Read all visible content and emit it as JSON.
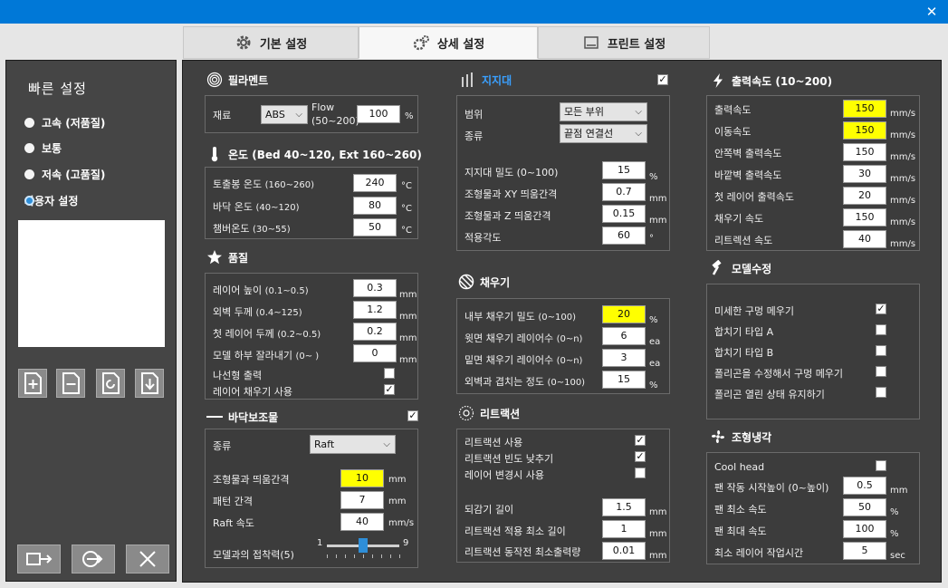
{
  "tabs": [
    {
      "label": "기본 설정"
    },
    {
      "label": "상세 설정"
    },
    {
      "label": "프린트 설정"
    }
  ],
  "quick": {
    "title": "빠른 설정",
    "options": [
      "고속 (저품질)",
      "보통",
      "저속 (고품질)",
      "사용자 설정"
    ]
  },
  "filament": {
    "title": "필라멘트",
    "material_label": "재료",
    "material_value": "ABS",
    "flow_label": "Flow",
    "flow_range": "(50~200)",
    "flow_value": "100",
    "flow_unit": "%"
  },
  "temp": {
    "title": "온도 (Bed 40~120, Ext 160~260)",
    "rows": [
      {
        "label": "토출봉 온도",
        "range": "(160~260)",
        "value": "240",
        "unit": "°C"
      },
      {
        "label": "바닥 온도",
        "range": "(40~120)",
        "value": "80",
        "unit": "°C"
      },
      {
        "label": "챔버온도",
        "range": "(30~55)",
        "value": "50",
        "unit": "°C"
      }
    ]
  },
  "quality": {
    "title": "품질",
    "rows": [
      {
        "label": "레이어 높이",
        "range": "(0.1~0.5)",
        "value": "0.3",
        "unit": "mm"
      },
      {
        "label": "외벽 두께",
        "range": "(0.4~125)",
        "value": "1.2",
        "unit": "mm"
      },
      {
        "label": "첫 레이어 두께",
        "range": "(0.2~0.5)",
        "value": "0.2",
        "unit": "mm"
      },
      {
        "label": "모델 하부 잘라내기",
        "range": "(0~ )",
        "value": "0",
        "unit": "mm"
      }
    ],
    "spiral_label": "나선형 출력",
    "fill_label": "레이어 채우기 사용"
  },
  "bottom": {
    "title": "바닥보조물",
    "type_label": "종류",
    "type_value": "Raft",
    "rows": [
      {
        "label": "조형물과 띄움간격",
        "value": "10",
        "unit": "mm"
      },
      {
        "label": "패턴 간격",
        "value": "7",
        "unit": "mm"
      },
      {
        "label": "Raft 속도",
        "value": "40",
        "unit": "mm/s"
      }
    ],
    "adhesion_label": "모델과의 접착력(5)",
    "slider_min": "1",
    "slider_max": "9",
    "adhesion_value": 5
  },
  "support": {
    "title": "지지대",
    "range_label": "범위",
    "range_value": "모든 부위",
    "type_label": "종류",
    "type_value": "끝점 연결선",
    "rows": [
      {
        "label": "지지대 밀도 (0~100)",
        "value": "15",
        "unit": "%"
      },
      {
        "label": "조형물과 XY 띄움간격",
        "value": "0.7",
        "unit": "mm"
      },
      {
        "label": "조형물과 Z 띄움간격",
        "value": "0.15",
        "unit": "mm"
      },
      {
        "label": "적용각도",
        "value": "60",
        "unit": "°"
      }
    ]
  },
  "infill": {
    "title": "채우기",
    "rows": [
      {
        "label": "내부 채우기 밀도",
        "range": "(0~100)",
        "value": "20",
        "unit": "%"
      },
      {
        "label": "윗면 채우기 레이어수",
        "range": "(0~n)",
        "value": "6",
        "unit": "ea"
      },
      {
        "label": "밑면 채우기 레이어수",
        "range": "(0~n)",
        "value": "3",
        "unit": "ea"
      },
      {
        "label": "외벽과 겹치는 정도",
        "range": "(0~100)",
        "value": "15",
        "unit": "%"
      }
    ]
  },
  "retraction": {
    "title": "리트랙션",
    "checks": [
      "리트랙션 사용",
      "리트랙션 빈도 낮추기",
      "레이어 변경시 사용"
    ],
    "rows": [
      {
        "label": "되감기 길이",
        "value": "1.5",
        "unit": "mm"
      },
      {
        "label": "리트랙션 적용 최소 길이",
        "value": "1",
        "unit": "mm"
      },
      {
        "label": "리트랙션 동작전 최소출력량",
        "value": "0.01",
        "unit": "mm"
      }
    ]
  },
  "speed": {
    "title": "출력속도 (10~200)",
    "rows": [
      {
        "label": "출력속도",
        "value": "150",
        "unit": "mm/s"
      },
      {
        "label": "이동속도",
        "value": "150",
        "unit": "mm/s"
      },
      {
        "label": "안쪽벽 출력속도",
        "value": "150",
        "unit": "mm/s"
      },
      {
        "label": "바깥벽 출력속도",
        "value": "30",
        "unit": "mm/s"
      },
      {
        "label": "첫 레이어 출력속도",
        "value": "20",
        "unit": "mm/s"
      },
      {
        "label": "채우기 속도",
        "value": "150",
        "unit": "mm/s"
      },
      {
        "label": "리트렉션 속도",
        "value": "40",
        "unit": "mm/s"
      }
    ]
  },
  "model_fix": {
    "title": "모델수정",
    "checks": [
      "미세한 구멍 메우기",
      "합치기 타입 A",
      "합치기 타입 B",
      "폴리곤을 수정해서 구멍 메우기",
      "폴리곤 열린 상태 유지하기"
    ]
  },
  "cooling": {
    "title": "조형냉각",
    "coolhead_label": "Cool head",
    "rows": [
      {
        "label": "팬 작동 시작높이 (0~높이)",
        "value": "0.5",
        "unit": "mm"
      },
      {
        "label": "팬 최소 속도",
        "value": "50",
        "unit": "%"
      },
      {
        "label": "팬 최대 속도",
        "value": "100",
        "unit": "%"
      },
      {
        "label": "최소 레이어 작업시간",
        "value": "5",
        "unit": "sec"
      }
    ]
  },
  "colors": {
    "accent": "#0078d7",
    "highlight": "#ffff00",
    "panel": "#404040"
  }
}
